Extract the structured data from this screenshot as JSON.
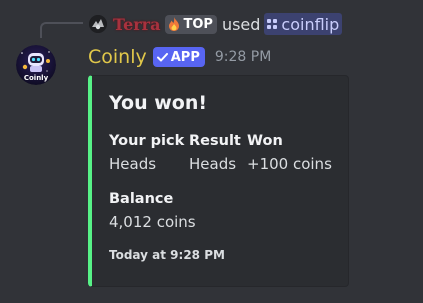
{
  "reply": {
    "username": "Terra",
    "tag": "TOP",
    "used_text": "used",
    "command": "coinflip"
  },
  "message": {
    "author": "Coinly",
    "badge": "APP",
    "timestamp": "9:28 PM",
    "avatar_text": "Coinly"
  },
  "embed": {
    "accent_color": "#57f287",
    "title": "You won!",
    "fields": [
      {
        "name": "Your pick",
        "value": "Heads"
      },
      {
        "name": "Result",
        "value": "Heads"
      },
      {
        "name": "Won",
        "value": "+100 coins"
      },
      {
        "name": "Balance",
        "value": "4,012 coins"
      }
    ],
    "footer": "Today at 9:28 PM"
  },
  "colors": {
    "background": "#313338",
    "author_color": "#e1c84a",
    "reply_name_color": "#a8323e",
    "app_badge": "#5865f2",
    "command_pill": "#3c4270"
  }
}
